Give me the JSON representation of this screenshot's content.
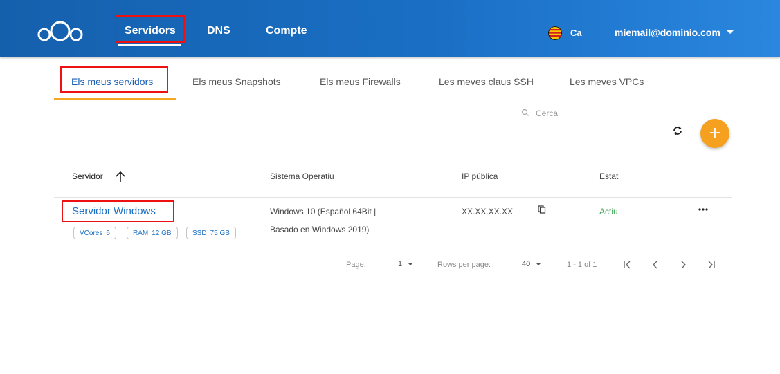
{
  "header": {
    "nav": {
      "servidors": "Servidors",
      "dns": "DNS",
      "compte": "Compte"
    },
    "language": "Ca",
    "user_email": "miemail@dominio.com"
  },
  "tabs": [
    {
      "label": "Els meus servidors",
      "active": true
    },
    {
      "label": "Els meus Snapshots",
      "active": false
    },
    {
      "label": "Els meus Firewalls",
      "active": false
    },
    {
      "label": "Les meves claus SSH",
      "active": false
    },
    {
      "label": "Les meves VPCs",
      "active": false
    }
  ],
  "search": {
    "placeholder": "Cerca"
  },
  "add_label": "+",
  "table": {
    "columns": {
      "servidor": "Servidor",
      "sistema_operatiu": "Sistema Operatiu",
      "ip_publica": "IP pública",
      "estat": "Estat"
    },
    "rows": [
      {
        "name": "Servidor Windows",
        "specs": [
          {
            "label": "VCores",
            "value": "6"
          },
          {
            "label": "RAM",
            "value": "12 GB"
          },
          {
            "label": "SSD",
            "value": "75 GB"
          }
        ],
        "os_line1": "Windows 10 (Español 64Bit |",
        "os_line2": "Basado en Windows 2019)",
        "ip": "XX.XX.XX.XX",
        "status": "Actiu"
      }
    ]
  },
  "pagination": {
    "page_label": "Page:",
    "page_value": "1",
    "rows_label": "Rows per page:",
    "rows_value": "40",
    "range": "1 - 1 of 1"
  },
  "colors": {
    "header_blue": "#1a6fc4",
    "accent_orange": "#f5a01e",
    "status_green": "#3a9d4f",
    "highlight_red": "#e11111"
  },
  "icons": [
    "logo-icon",
    "flag-icon",
    "chevron-down-icon",
    "search-icon",
    "refresh-icon",
    "plus-icon",
    "arrow-up-icon",
    "copy-icon",
    "more-icon",
    "first-page-icon",
    "prev-page-icon",
    "next-page-icon",
    "last-page-icon"
  ]
}
